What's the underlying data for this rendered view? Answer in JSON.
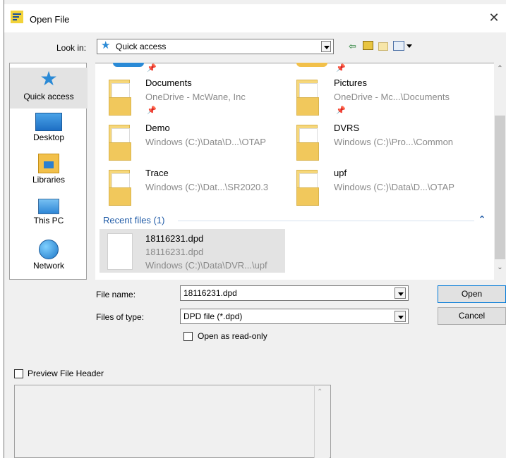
{
  "window": {
    "title": "Open File",
    "close_icon": "✕"
  },
  "lookin": {
    "label": "Look in:",
    "value": "Quick access"
  },
  "places": [
    {
      "label": "Quick access",
      "icon": "star-icon"
    },
    {
      "label": "Desktop",
      "icon": "desktop-icon"
    },
    {
      "label": "Libraries",
      "icon": "libraries-icon"
    },
    {
      "label": "This PC",
      "icon": "computer-icon"
    },
    {
      "label": "Network",
      "icon": "network-icon"
    }
  ],
  "files": {
    "pinned": [
      {
        "name": "Documents",
        "location": "OneDrive - McWane, Inc"
      },
      {
        "name": "Pictures",
        "location": "OneDrive - Mc...\\Documents"
      },
      {
        "name": "Demo",
        "location": "Windows (C:)\\Data\\D...\\OTAP"
      },
      {
        "name": "DVRS",
        "location": "Windows (C:)\\Pro...\\Common"
      },
      {
        "name": "Trace",
        "location": "Windows (C:)\\Dat...\\SR2020.3"
      },
      {
        "name": "upf",
        "location": "Windows (C:)\\Data\\D...\\OTAP"
      }
    ],
    "recent_header": "Recent files (1)",
    "recent": [
      {
        "name": "18116231.dpd",
        "sub": "18116231.dpd",
        "location": "Windows (C:)\\Data\\DVR...\\upf"
      }
    ]
  },
  "form": {
    "filename_label": "File name:",
    "filename_value": "18116231.dpd",
    "filetype_label": "Files of type:",
    "filetype_value": "DPD file (*.dpd)",
    "readonly_label": "Open as read-only",
    "open_label": "Open",
    "cancel_label": "Cancel",
    "preview_label": "Preview File Header"
  },
  "colors": {
    "accent": "#2a8ad6",
    "recent_header": "#1f5aa6",
    "selected_bg": "#e3e3e3"
  }
}
